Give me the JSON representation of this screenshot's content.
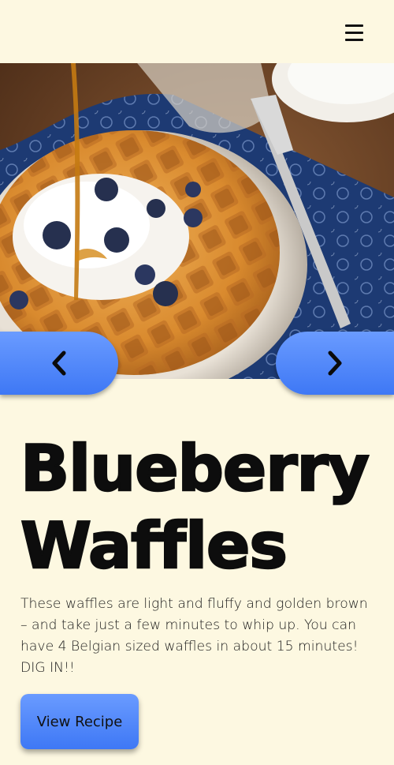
{
  "header": {
    "menu_icon": "hamburger-menu-icon"
  },
  "hero": {
    "image": "waffle-photo",
    "prev_icon": "chevron-left-icon",
    "next_icon": "chevron-right-icon"
  },
  "recipe": {
    "title_line1": "Blueberry",
    "title_line2": "Waffles",
    "description": "These waffles are light and fluffy and golden brown – and take just a few minutes to whip up. You can have 4 Belgian sized waffles in about 15 minutes! DIG IN!!",
    "button_label": "View Recipe"
  },
  "colors": {
    "background": "#fdf8e1",
    "accent": "#4a86ff",
    "text": "#0d0d0d"
  }
}
